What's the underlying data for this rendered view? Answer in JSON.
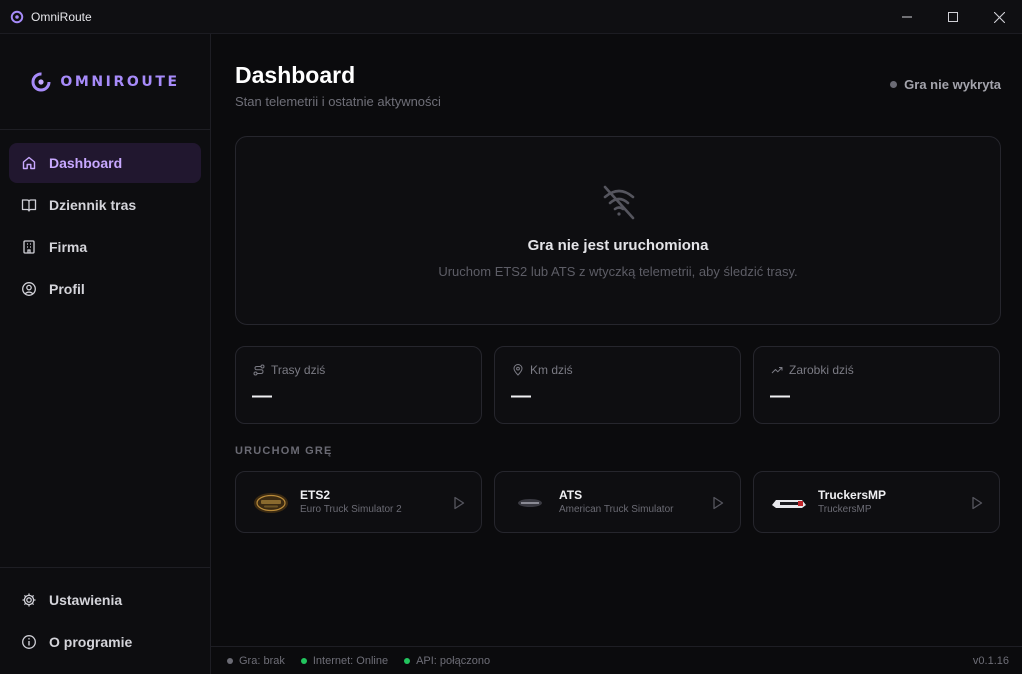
{
  "window": {
    "title": "OmniRoute"
  },
  "logo": {
    "text": "OMNIROUTE"
  },
  "sidebar": {
    "items": [
      {
        "label": "Dashboard",
        "icon": "home-icon",
        "active": true
      },
      {
        "label": "Dziennik tras",
        "icon": "book-icon"
      },
      {
        "label": "Firma",
        "icon": "building-icon"
      },
      {
        "label": "Profil",
        "icon": "user-icon"
      }
    ],
    "bottom": [
      {
        "label": "Ustawienia",
        "icon": "gear-icon"
      },
      {
        "label": "O programie",
        "icon": "info-icon"
      }
    ]
  },
  "header": {
    "title": "Dashboard",
    "subtitle": "Stan telemetrii i ostatnie aktywności",
    "game_status": "Gra nie wykryta"
  },
  "hero": {
    "icon": "wifi-off-icon",
    "title": "Gra nie jest uruchomiona",
    "subtitle": "Uruchom ETS2 lub ATS z wtyczką telemetrii, aby śledzić trasy."
  },
  "stats": [
    {
      "label": "Trasy dziś",
      "icon": "route-icon",
      "value": "—"
    },
    {
      "label": "Km dziś",
      "icon": "map-pin-icon",
      "value": "—"
    },
    {
      "label": "Zarobki dziś",
      "icon": "trending-up-icon",
      "value": "—"
    }
  ],
  "launch": {
    "section_label": "URUCHOM GRĘ",
    "games": [
      {
        "name": "ETS2",
        "description": "Euro Truck Simulator 2"
      },
      {
        "name": "ATS",
        "description": "American Truck Simulator"
      },
      {
        "name": "TruckersMP",
        "description": "TruckersMP"
      }
    ]
  },
  "statusbar": {
    "game": "Gra: brak",
    "internet": "Internet: Online",
    "api": "API: połączono",
    "version": "v0.1.16"
  },
  "colors": {
    "accent": "#a78bfa",
    "active_bg": "#21172f",
    "online": "#22c55e",
    "offline": "#6b6b74"
  }
}
